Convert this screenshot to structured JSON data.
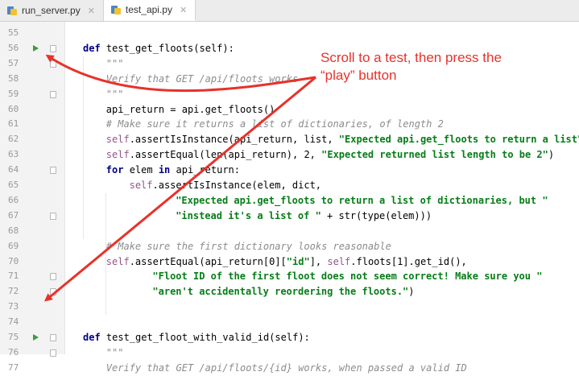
{
  "tabs": [
    {
      "label": "run_server.py",
      "active": false
    },
    {
      "label": "test_api.py",
      "active": true
    }
  ],
  "annotation": {
    "line1": "Scroll to a test, then press the",
    "line2": "“play” button"
  },
  "colors": {
    "annotation": "#e8312a",
    "run_icon": "#3d9a3d"
  },
  "lines": [
    {
      "num": "55",
      "indent": 0,
      "run": false,
      "fold": false,
      "segments": []
    },
    {
      "num": "56",
      "indent": 0,
      "run": true,
      "fold": true,
      "segments": [
        {
          "t": "def ",
          "c": "kw"
        },
        {
          "t": "test_get_floots",
          "c": "fn"
        },
        {
          "t": "(self):",
          "c": "call"
        }
      ]
    },
    {
      "num": "57",
      "indent": 1,
      "run": false,
      "fold": true,
      "segments": [
        {
          "t": "\"\"\"",
          "c": "doc"
        }
      ]
    },
    {
      "num": "58",
      "indent": 1,
      "run": false,
      "fold": false,
      "segments": [
        {
          "t": "Verify that GET /api/floots works",
          "c": "doc"
        }
      ]
    },
    {
      "num": "59",
      "indent": 1,
      "run": false,
      "fold": true,
      "segments": [
        {
          "t": "\"\"\"",
          "c": "doc"
        }
      ]
    },
    {
      "num": "60",
      "indent": 1,
      "run": false,
      "fold": false,
      "segments": [
        {
          "t": "api_return = api.get_floots()",
          "c": "call"
        }
      ]
    },
    {
      "num": "61",
      "indent": 1,
      "run": false,
      "fold": false,
      "segments": [
        {
          "t": "# Make sure it returns a list of dictionaries, of length 2",
          "c": "cmt"
        }
      ]
    },
    {
      "num": "62",
      "indent": 1,
      "run": false,
      "fold": false,
      "segments": [
        {
          "t": "self",
          "c": "self"
        },
        {
          "t": ".assertIsInstance(api_return, list, ",
          "c": "call"
        },
        {
          "t": "\"Expected api.get_floots to return a list\"",
          "c": "str"
        },
        {
          "t": ")",
          "c": "call"
        }
      ]
    },
    {
      "num": "63",
      "indent": 1,
      "run": false,
      "fold": false,
      "segments": [
        {
          "t": "self",
          "c": "self"
        },
        {
          "t": ".assertEqual(len(api_return), 2, ",
          "c": "call"
        },
        {
          "t": "\"Expected returned list length to be 2\"",
          "c": "str"
        },
        {
          "t": ")",
          "c": "call"
        }
      ]
    },
    {
      "num": "64",
      "indent": 1,
      "run": false,
      "fold": true,
      "segments": [
        {
          "t": "for ",
          "c": "kw"
        },
        {
          "t": "elem ",
          "c": "call"
        },
        {
          "t": "in ",
          "c": "kw"
        },
        {
          "t": "api_return:",
          "c": "call"
        }
      ]
    },
    {
      "num": "65",
      "indent": 2,
      "run": false,
      "fold": false,
      "segments": [
        {
          "t": "self",
          "c": "self"
        },
        {
          "t": ".assertIsInstance(elem, dict,",
          "c": "call"
        }
      ]
    },
    {
      "num": "66",
      "indent": 4,
      "run": false,
      "fold": false,
      "segments": [
        {
          "t": "\"Expected api.get_floots to return a list of dictionaries, but \"",
          "c": "str"
        }
      ]
    },
    {
      "num": "67",
      "indent": 4,
      "run": false,
      "fold": true,
      "segments": [
        {
          "t": "\"instead it's a list of \"",
          "c": "str"
        },
        {
          "t": " + str(type(elem)))",
          "c": "call"
        }
      ]
    },
    {
      "num": "68",
      "indent": 0,
      "run": false,
      "fold": false,
      "segments": []
    },
    {
      "num": "69",
      "indent": 1,
      "run": false,
      "fold": false,
      "segments": [
        {
          "t": "# Make sure the first dictionary looks reasonable",
          "c": "cmt"
        }
      ]
    },
    {
      "num": "70",
      "indent": 1,
      "run": false,
      "fold": false,
      "segments": [
        {
          "t": "self",
          "c": "self"
        },
        {
          "t": ".assertEqual(api_return[0][",
          "c": "call"
        },
        {
          "t": "\"id\"",
          "c": "str"
        },
        {
          "t": "], ",
          "c": "call"
        },
        {
          "t": "self",
          "c": "self"
        },
        {
          "t": ".floots[1].get_id(),",
          "c": "call"
        }
      ]
    },
    {
      "num": "71",
      "indent": 3,
      "run": false,
      "fold": true,
      "segments": [
        {
          "t": "\"Floot ID of the first floot does not seem correct! Make sure you \"",
          "c": "str"
        }
      ]
    },
    {
      "num": "72",
      "indent": 3,
      "run": false,
      "fold": true,
      "segments": [
        {
          "t": "\"aren't accidentally reordering the floots.\"",
          "c": "str"
        },
        {
          "t": ")",
          "c": "call"
        }
      ]
    },
    {
      "num": "73",
      "indent": 0,
      "run": false,
      "fold": false,
      "segments": []
    },
    {
      "num": "74",
      "indent": 0,
      "run": false,
      "fold": false,
      "segments": []
    },
    {
      "num": "75",
      "indent": 0,
      "run": true,
      "fold": true,
      "segments": [
        {
          "t": "def ",
          "c": "kw"
        },
        {
          "t": "test_get_floot_with_valid_id",
          "c": "fn"
        },
        {
          "t": "(self):",
          "c": "call"
        }
      ]
    },
    {
      "num": "76",
      "indent": 1,
      "run": false,
      "fold": true,
      "segments": [
        {
          "t": "\"\"\"",
          "c": "doc"
        }
      ]
    },
    {
      "num": "77",
      "indent": 1,
      "run": false,
      "fold": false,
      "segments": [
        {
          "t": "Verify that GET /api/floots/{id} works, when passed a valid ID",
          "c": "doc"
        }
      ]
    }
  ]
}
